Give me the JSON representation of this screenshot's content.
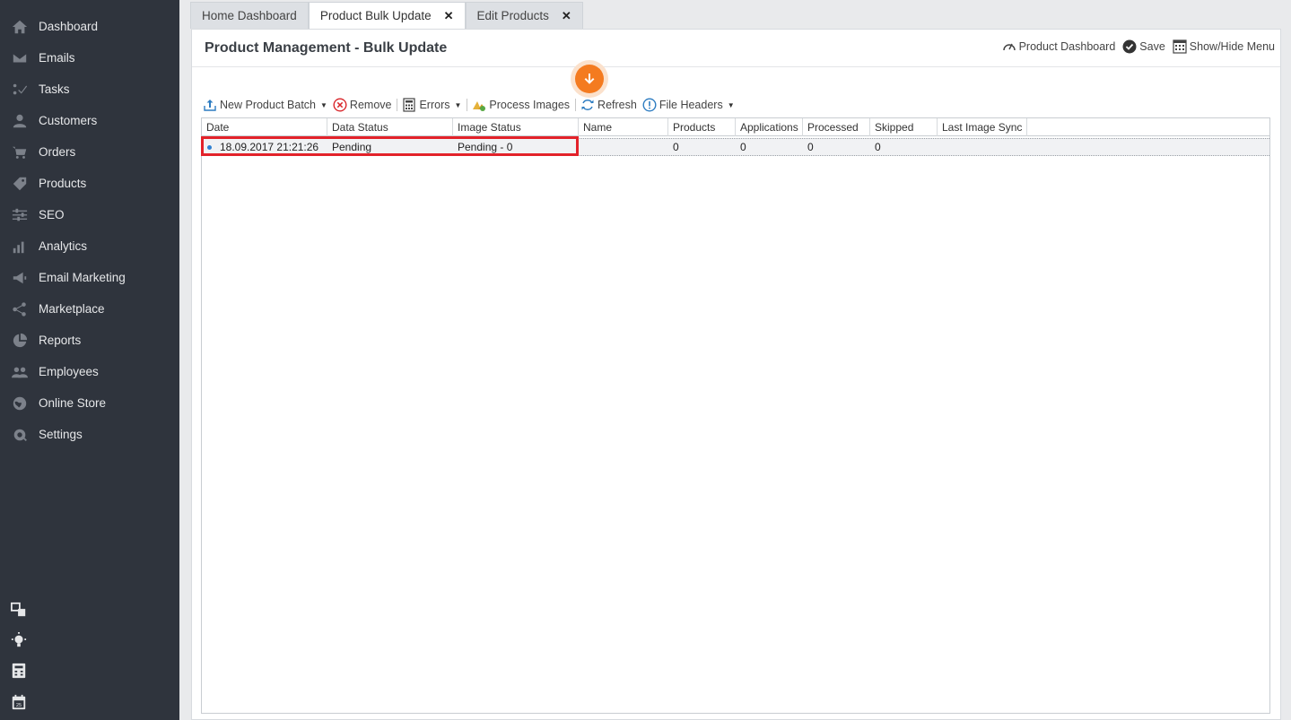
{
  "sidebar": {
    "items": [
      {
        "label": "Dashboard",
        "icon": "home-icon"
      },
      {
        "label": "Emails",
        "icon": "envelope-icon"
      },
      {
        "label": "Tasks",
        "icon": "tasks-icon"
      },
      {
        "label": "Customers",
        "icon": "user-icon"
      },
      {
        "label": "Orders",
        "icon": "cart-icon"
      },
      {
        "label": "Products",
        "icon": "tag-icon"
      },
      {
        "label": "SEO",
        "icon": "sliders-icon"
      },
      {
        "label": "Analytics",
        "icon": "bar-chart-icon"
      },
      {
        "label": "Email Marketing",
        "icon": "megaphone-icon"
      },
      {
        "label": "Marketplace",
        "icon": "share-icon"
      },
      {
        "label": "Reports",
        "icon": "pie-chart-icon"
      },
      {
        "label": "Employees",
        "icon": "users-icon"
      },
      {
        "label": "Online Store",
        "icon": "globe-icon"
      },
      {
        "label": "Settings",
        "icon": "gear-icon"
      }
    ]
  },
  "tabs": [
    {
      "label": "Home Dashboard",
      "closable": false,
      "active": false
    },
    {
      "label": "Product Bulk Update",
      "closable": true,
      "active": true
    },
    {
      "label": "Edit Products",
      "closable": true,
      "active": false
    }
  ],
  "page": {
    "title": "Product Management - Bulk Update",
    "actions": {
      "product_dashboard": "Product Dashboard",
      "save": "Save",
      "show_hide_menu": "Show/Hide Menu"
    }
  },
  "toolbar": {
    "new_product_batch": "New Product Batch",
    "remove": "Remove",
    "errors": "Errors",
    "process_images": "Process Images",
    "refresh": "Refresh",
    "file_headers": "File Headers"
  },
  "grid": {
    "columns": [
      "Date",
      "Data Status",
      "Image Status",
      "Name",
      "Products",
      "Applications",
      "Processed",
      "Skipped",
      "Last Image Sync"
    ],
    "rows": [
      {
        "date": "18.09.2017 21:21:26",
        "data_status": "Pending",
        "image_status": "Pending - 0",
        "name": "",
        "products": "0",
        "applications": "0",
        "processed": "0",
        "skipped": "0",
        "last_image_sync": ""
      }
    ]
  },
  "colors": {
    "sidebar_bg": "#2f343d",
    "accent_orange": "#f47b20",
    "highlight_red": "#e3222a",
    "row_dot_blue": "#2f80d1"
  }
}
